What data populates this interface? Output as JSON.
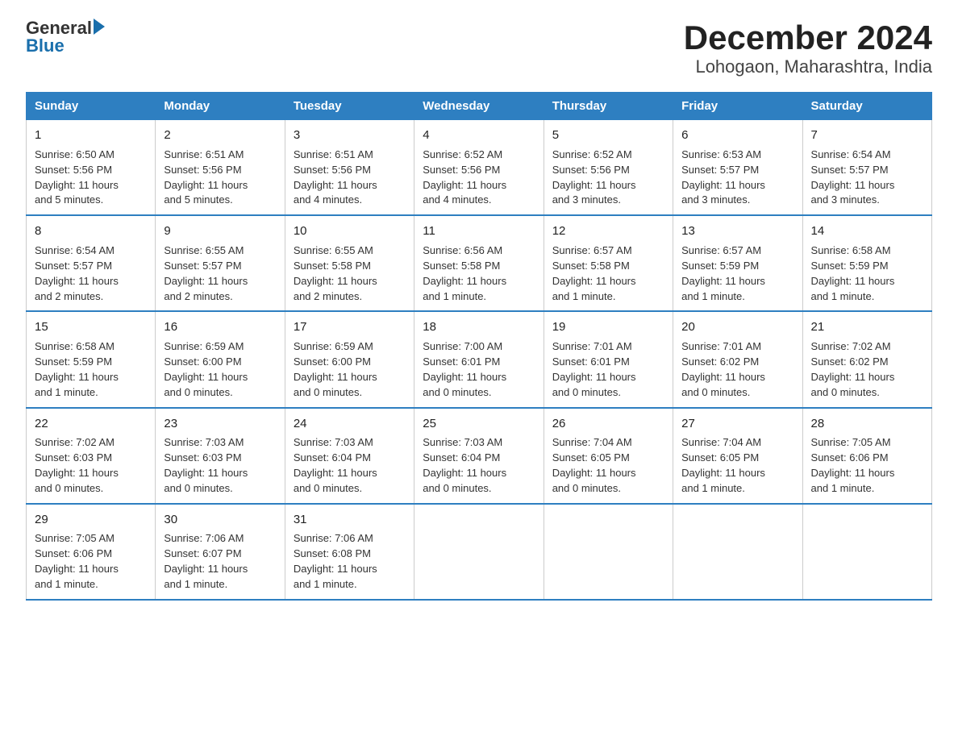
{
  "logo": {
    "general": "General",
    "blue": "Blue"
  },
  "title": "December 2024",
  "subtitle": "Lohogaon, Maharashtra, India",
  "days_of_week": [
    "Sunday",
    "Monday",
    "Tuesday",
    "Wednesday",
    "Thursday",
    "Friday",
    "Saturday"
  ],
  "weeks": [
    [
      {
        "day": "1",
        "info": "Sunrise: 6:50 AM\nSunset: 5:56 PM\nDaylight: 11 hours\nand 5 minutes."
      },
      {
        "day": "2",
        "info": "Sunrise: 6:51 AM\nSunset: 5:56 PM\nDaylight: 11 hours\nand 5 minutes."
      },
      {
        "day": "3",
        "info": "Sunrise: 6:51 AM\nSunset: 5:56 PM\nDaylight: 11 hours\nand 4 minutes."
      },
      {
        "day": "4",
        "info": "Sunrise: 6:52 AM\nSunset: 5:56 PM\nDaylight: 11 hours\nand 4 minutes."
      },
      {
        "day": "5",
        "info": "Sunrise: 6:52 AM\nSunset: 5:56 PM\nDaylight: 11 hours\nand 3 minutes."
      },
      {
        "day": "6",
        "info": "Sunrise: 6:53 AM\nSunset: 5:57 PM\nDaylight: 11 hours\nand 3 minutes."
      },
      {
        "day": "7",
        "info": "Sunrise: 6:54 AM\nSunset: 5:57 PM\nDaylight: 11 hours\nand 3 minutes."
      }
    ],
    [
      {
        "day": "8",
        "info": "Sunrise: 6:54 AM\nSunset: 5:57 PM\nDaylight: 11 hours\nand 2 minutes."
      },
      {
        "day": "9",
        "info": "Sunrise: 6:55 AM\nSunset: 5:57 PM\nDaylight: 11 hours\nand 2 minutes."
      },
      {
        "day": "10",
        "info": "Sunrise: 6:55 AM\nSunset: 5:58 PM\nDaylight: 11 hours\nand 2 minutes."
      },
      {
        "day": "11",
        "info": "Sunrise: 6:56 AM\nSunset: 5:58 PM\nDaylight: 11 hours\nand 1 minute."
      },
      {
        "day": "12",
        "info": "Sunrise: 6:57 AM\nSunset: 5:58 PM\nDaylight: 11 hours\nand 1 minute."
      },
      {
        "day": "13",
        "info": "Sunrise: 6:57 AM\nSunset: 5:59 PM\nDaylight: 11 hours\nand 1 minute."
      },
      {
        "day": "14",
        "info": "Sunrise: 6:58 AM\nSunset: 5:59 PM\nDaylight: 11 hours\nand 1 minute."
      }
    ],
    [
      {
        "day": "15",
        "info": "Sunrise: 6:58 AM\nSunset: 5:59 PM\nDaylight: 11 hours\nand 1 minute."
      },
      {
        "day": "16",
        "info": "Sunrise: 6:59 AM\nSunset: 6:00 PM\nDaylight: 11 hours\nand 0 minutes."
      },
      {
        "day": "17",
        "info": "Sunrise: 6:59 AM\nSunset: 6:00 PM\nDaylight: 11 hours\nand 0 minutes."
      },
      {
        "day": "18",
        "info": "Sunrise: 7:00 AM\nSunset: 6:01 PM\nDaylight: 11 hours\nand 0 minutes."
      },
      {
        "day": "19",
        "info": "Sunrise: 7:01 AM\nSunset: 6:01 PM\nDaylight: 11 hours\nand 0 minutes."
      },
      {
        "day": "20",
        "info": "Sunrise: 7:01 AM\nSunset: 6:02 PM\nDaylight: 11 hours\nand 0 minutes."
      },
      {
        "day": "21",
        "info": "Sunrise: 7:02 AM\nSunset: 6:02 PM\nDaylight: 11 hours\nand 0 minutes."
      }
    ],
    [
      {
        "day": "22",
        "info": "Sunrise: 7:02 AM\nSunset: 6:03 PM\nDaylight: 11 hours\nand 0 minutes."
      },
      {
        "day": "23",
        "info": "Sunrise: 7:03 AM\nSunset: 6:03 PM\nDaylight: 11 hours\nand 0 minutes."
      },
      {
        "day": "24",
        "info": "Sunrise: 7:03 AM\nSunset: 6:04 PM\nDaylight: 11 hours\nand 0 minutes."
      },
      {
        "day": "25",
        "info": "Sunrise: 7:03 AM\nSunset: 6:04 PM\nDaylight: 11 hours\nand 0 minutes."
      },
      {
        "day": "26",
        "info": "Sunrise: 7:04 AM\nSunset: 6:05 PM\nDaylight: 11 hours\nand 0 minutes."
      },
      {
        "day": "27",
        "info": "Sunrise: 7:04 AM\nSunset: 6:05 PM\nDaylight: 11 hours\nand 1 minute."
      },
      {
        "day": "28",
        "info": "Sunrise: 7:05 AM\nSunset: 6:06 PM\nDaylight: 11 hours\nand 1 minute."
      }
    ],
    [
      {
        "day": "29",
        "info": "Sunrise: 7:05 AM\nSunset: 6:06 PM\nDaylight: 11 hours\nand 1 minute."
      },
      {
        "day": "30",
        "info": "Sunrise: 7:06 AM\nSunset: 6:07 PM\nDaylight: 11 hours\nand 1 minute."
      },
      {
        "day": "31",
        "info": "Sunrise: 7:06 AM\nSunset: 6:08 PM\nDaylight: 11 hours\nand 1 minute."
      },
      null,
      null,
      null,
      null
    ]
  ]
}
